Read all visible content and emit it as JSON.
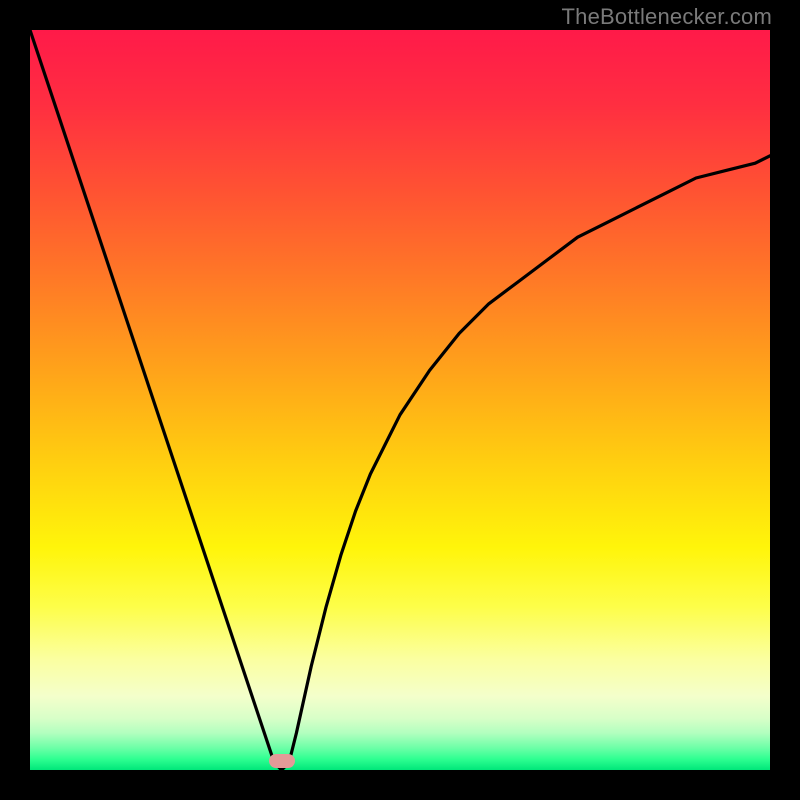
{
  "watermark": "TheBottlenecker.com",
  "chart_data": {
    "type": "line",
    "title": "",
    "xlabel": "",
    "ylabel": "",
    "xlim": [
      0,
      100
    ],
    "ylim": [
      0,
      100
    ],
    "x": [
      0,
      2,
      4,
      6,
      8,
      10,
      12,
      14,
      16,
      18,
      20,
      22,
      24,
      26,
      28,
      30,
      32,
      33,
      34,
      35,
      36,
      38,
      40,
      42,
      44,
      46,
      48,
      50,
      54,
      58,
      62,
      66,
      70,
      74,
      78,
      82,
      86,
      90,
      94,
      98,
      100
    ],
    "values": [
      100,
      94,
      88,
      82,
      76,
      70,
      64,
      58,
      52,
      46,
      40,
      34,
      28,
      22,
      16,
      10,
      4,
      1,
      0,
      1,
      5,
      14,
      22,
      29,
      35,
      40,
      44,
      48,
      54,
      59,
      63,
      66,
      69,
      72,
      74,
      76,
      78,
      80,
      81,
      82,
      83
    ],
    "notch": {
      "x": 34,
      "y": 0
    },
    "gradient_stops": [
      {
        "pct": 0,
        "color": "#ff1a49"
      },
      {
        "pct": 22,
        "color": "#ff5332"
      },
      {
        "pct": 46,
        "color": "#ffa31a"
      },
      {
        "pct": 70,
        "color": "#fff50a"
      },
      {
        "pct": 90,
        "color": "#f4ffcb"
      },
      {
        "pct": 97,
        "color": "#6dffa7"
      },
      {
        "pct": 100,
        "color": "#00e77a"
      }
    ],
    "marker": {
      "x": 34,
      "y": 1.2,
      "color": "#e39a98"
    }
  }
}
